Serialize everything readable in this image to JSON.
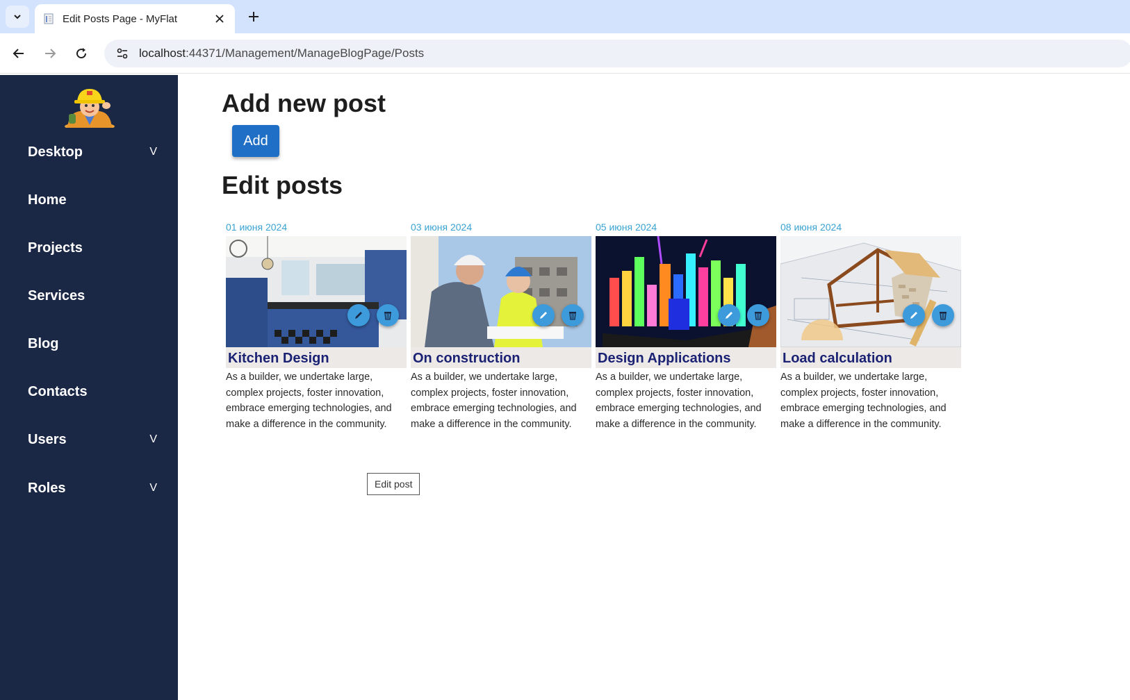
{
  "browser": {
    "tab_title": "Edit Posts Page - MyFlat",
    "url_host": "localhost",
    "url_path": ":44371/Management/ManageBlogPage/Posts"
  },
  "sidebar": {
    "items": [
      {
        "label": "Desktop",
        "expandable": true,
        "chevron": "V"
      },
      {
        "label": "Home",
        "expandable": false
      },
      {
        "label": "Projects",
        "expandable": false
      },
      {
        "label": "Services",
        "expandable": false
      },
      {
        "label": "Blog",
        "expandable": false
      },
      {
        "label": "Contacts",
        "expandable": false
      },
      {
        "label": "Users",
        "expandable": true,
        "chevron": "V"
      },
      {
        "label": "Roles",
        "expandable": true,
        "chevron": "V"
      }
    ]
  },
  "main": {
    "add_heading": "Add new post",
    "add_button": "Add",
    "edit_heading": "Edit posts",
    "posts": [
      {
        "date": "01 июня 2024",
        "title": "Kitchen Design",
        "text": "As a builder, we undertake large, complex projects, foster innovation, embrace emerging technologies, and make a difference in the community."
      },
      {
        "date": "03 июня 2024",
        "title": "On construction",
        "text": "As a builder, we undertake large, complex projects, foster innovation, embrace emerging technologies, and make a difference in the community."
      },
      {
        "date": "05 июня 2024",
        "title": "Design Applications",
        "text": "As a builder, we undertake large, complex projects, foster innovation, embrace emerging technologies, and make a difference in the community."
      },
      {
        "date": "08 июня 2024",
        "title": "Load calculation",
        "text": "As a builder, we undertake large, complex projects, foster innovation, embrace emerging technologies, and make a difference in the community."
      }
    ],
    "tooltip": "Edit post"
  },
  "icons": {
    "edit": "pencil-icon",
    "delete": "trash-icon"
  },
  "colors": {
    "sidebar_bg": "#1b2845",
    "accent": "#1e6fc5",
    "date": "#3aa3d3",
    "title": "#1b2274",
    "round_button": "#3d9bdc"
  }
}
